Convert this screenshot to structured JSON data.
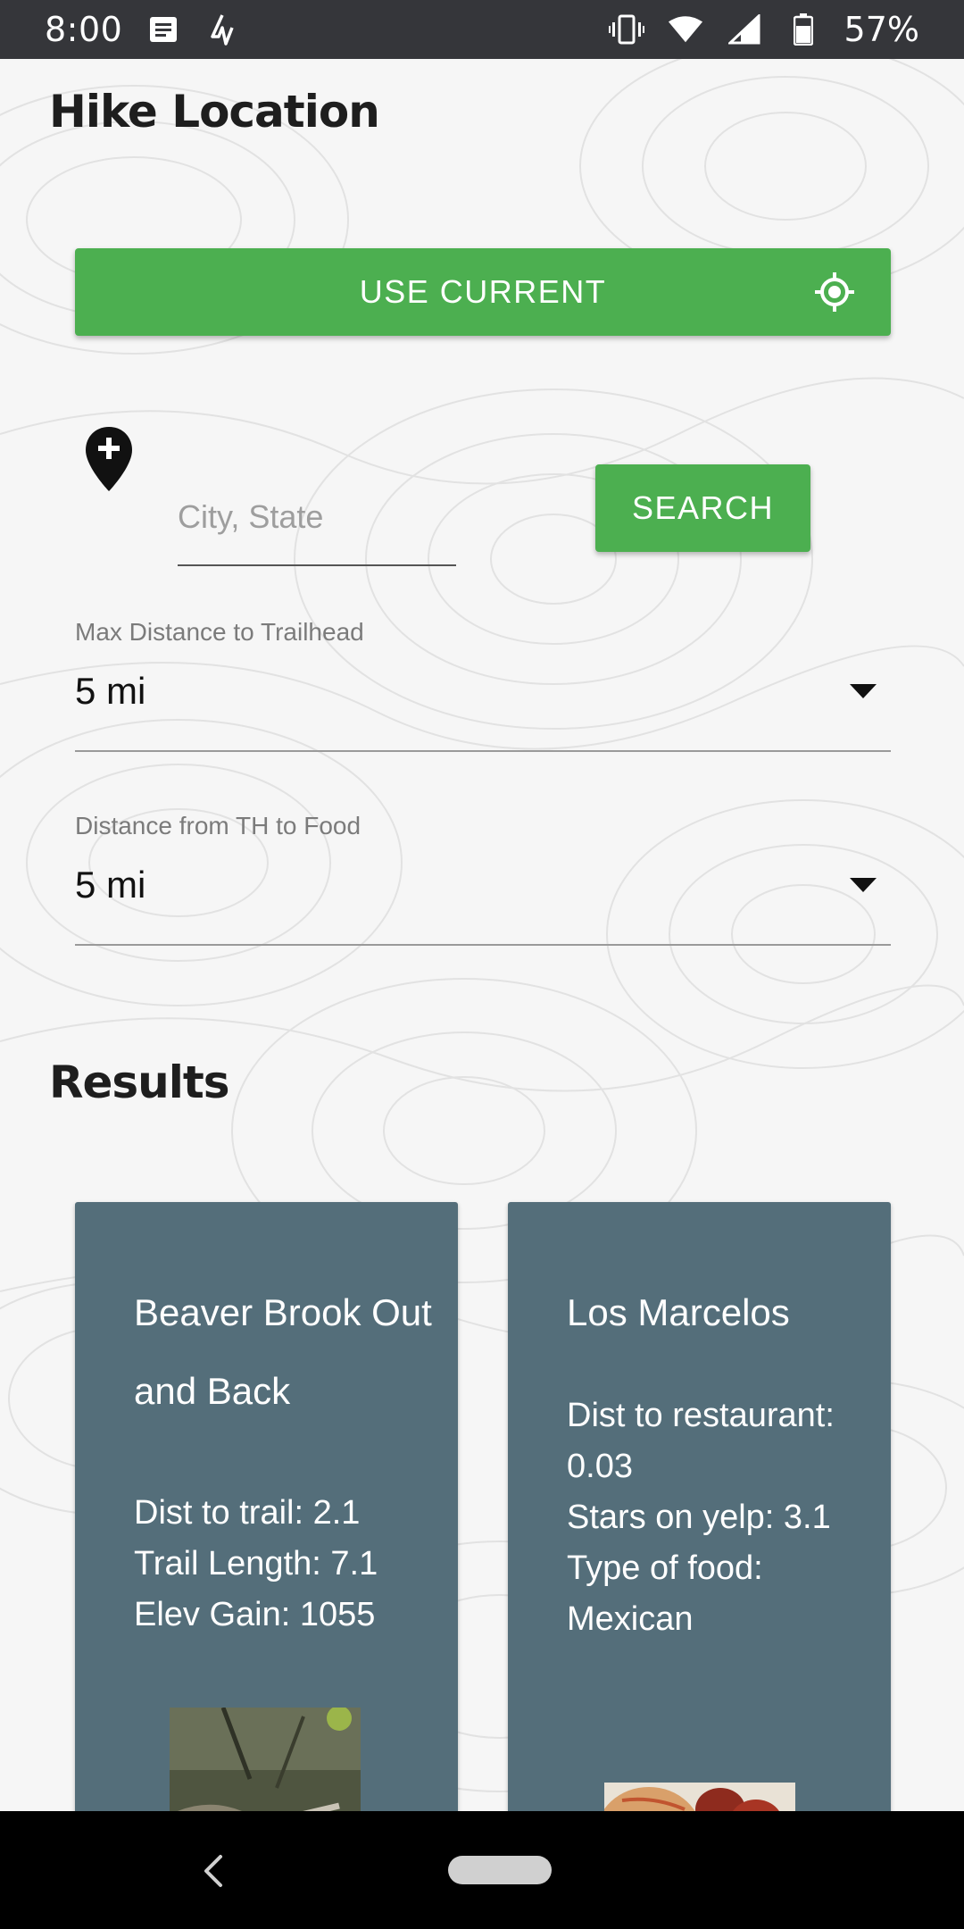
{
  "status_bar": {
    "time": "8:00",
    "battery": "57%",
    "icons": [
      "message-icon",
      "activity-icon",
      "vibrate-icon",
      "wifi-icon",
      "signal-icon",
      "battery-icon"
    ]
  },
  "hike_location": {
    "title": "Hike Location",
    "use_current_label": "USE CURRENT",
    "city_placeholder": "City, State",
    "city_value": "",
    "search_label": "SEARCH"
  },
  "max_distance": {
    "label": "Max Distance to Trailhead",
    "value": "5 mi"
  },
  "food_distance": {
    "label": "Distance from TH to Food",
    "value": "5 mi"
  },
  "results": {
    "title": "Results",
    "trail_card": {
      "title": "Beaver Brook Out and Back",
      "lines": [
        "Dist to trail: 2.1",
        "Trail Length: 7.1",
        "Elev Gain: 1055"
      ]
    },
    "food_card": {
      "title": "Los Marcelos",
      "lines": [
        "Dist to restaurant: 0.03",
        "Stars on yelp: 3.1",
        "Type of food: Mexican"
      ]
    }
  },
  "colors": {
    "accent_green": "#4caf50",
    "card_slate": "#546e7a",
    "status_bar": "#35363a"
  }
}
